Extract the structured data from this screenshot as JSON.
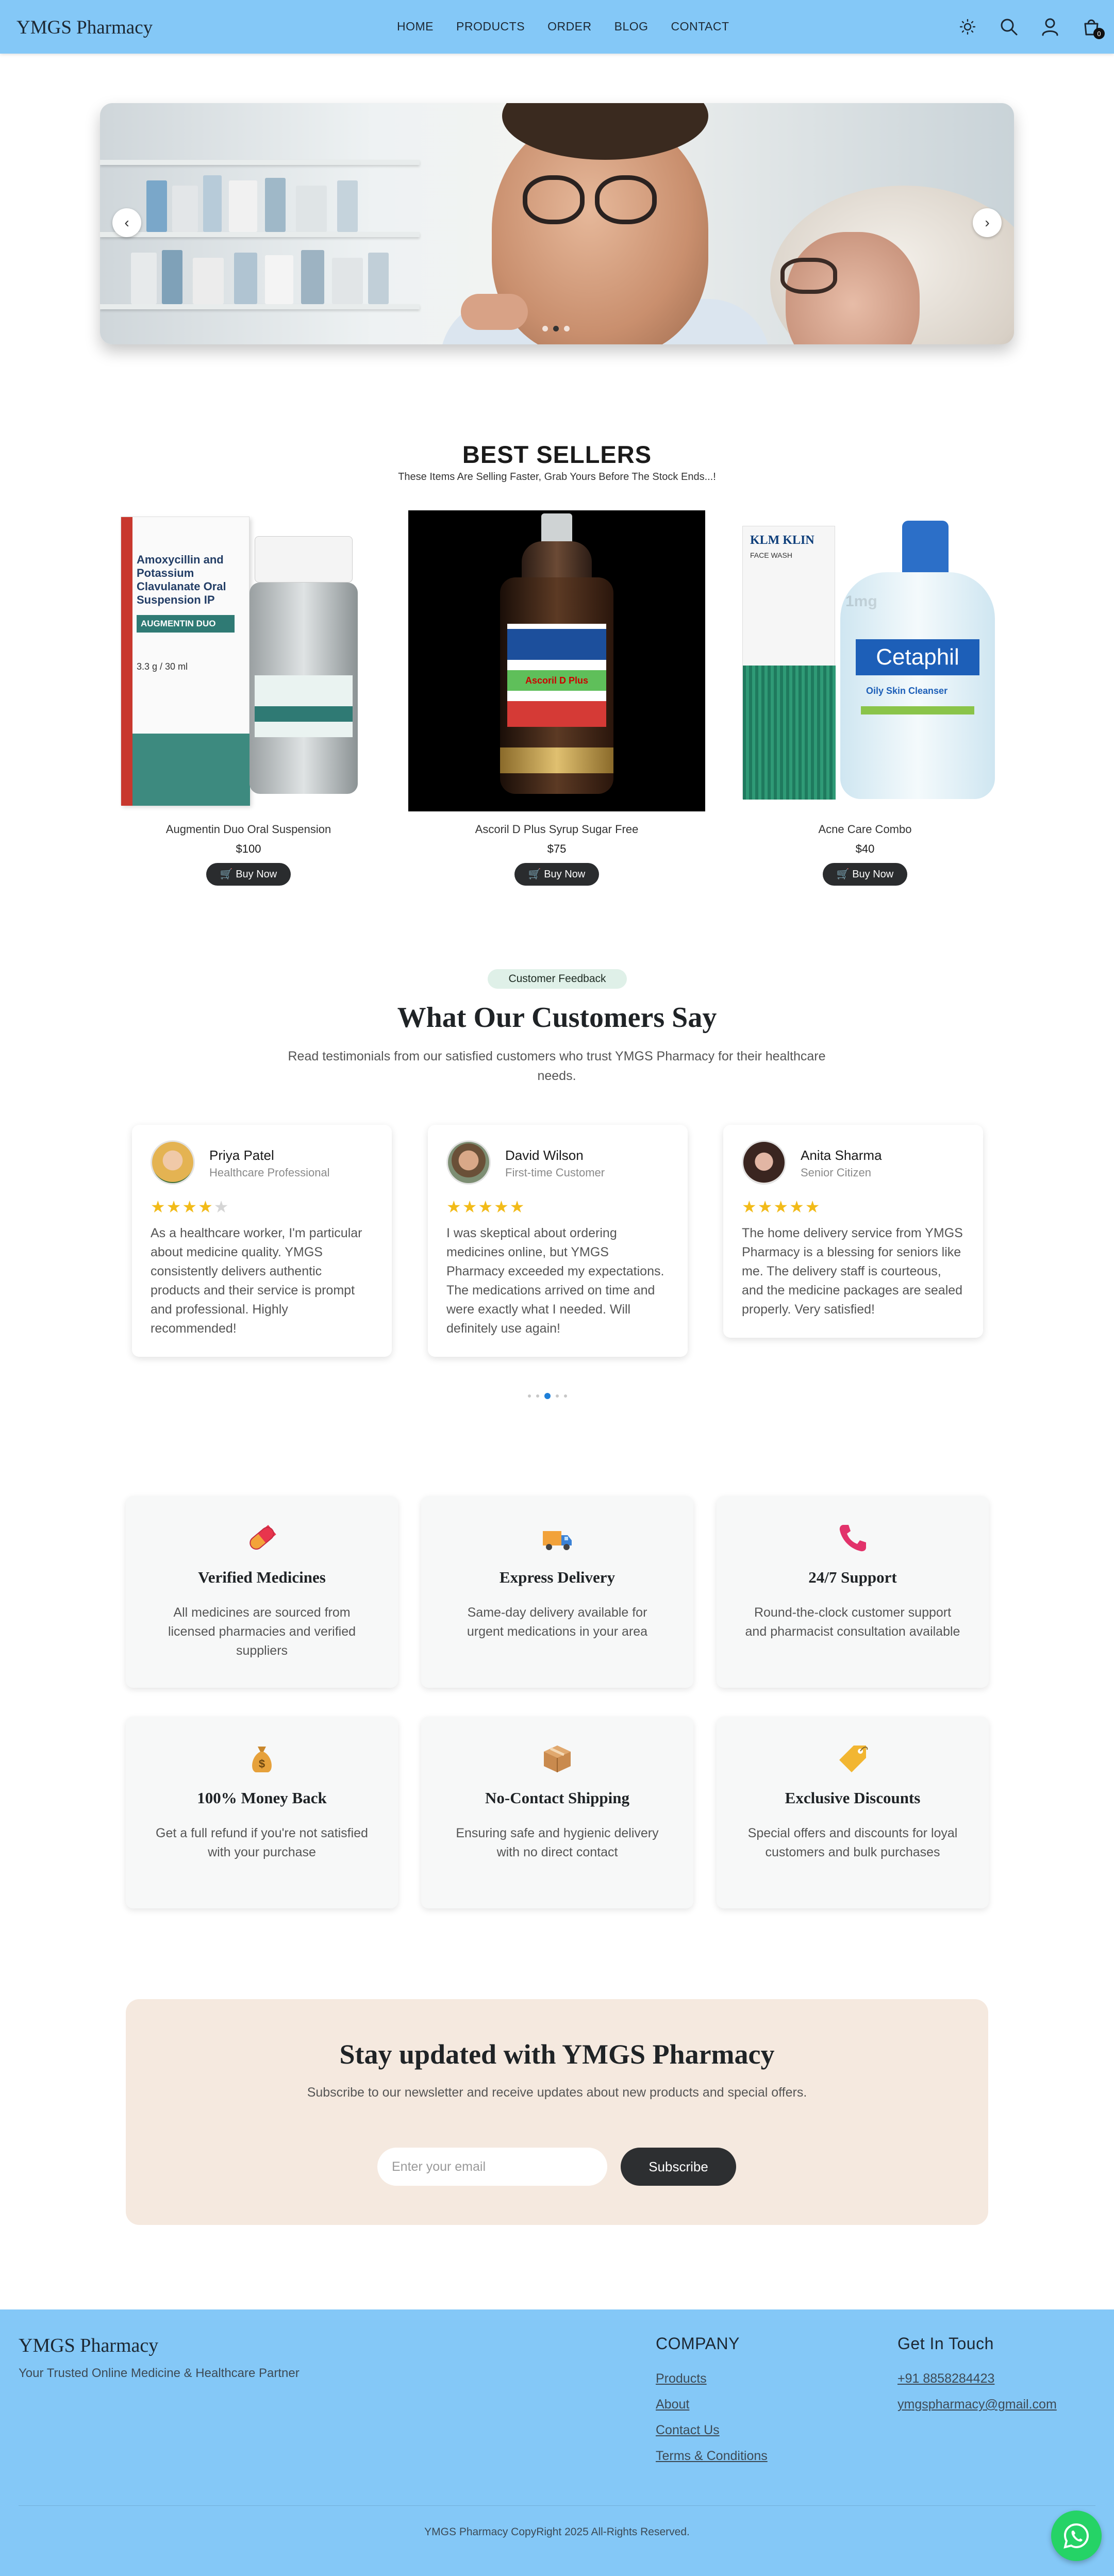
{
  "header": {
    "logo": "YMGS Pharmacy",
    "nav": [
      "HOME",
      "PRODUCTS",
      "ORDER",
      "BLOG",
      "CONTACT"
    ],
    "icons": [
      "sun-icon",
      "search-icon",
      "user-icon",
      "cart-icon"
    ],
    "cart_count": "0",
    "background": "#84c8f7"
  },
  "hero": {
    "prev_symbol": "‹",
    "next_symbol": "›",
    "slide_count": 3,
    "active_slide": 2
  },
  "best_sellers": {
    "title": "BEST SELLERS",
    "subtitle": "These Items Are Selling Faster, Grab Yours Before The Stock Ends...!",
    "products": [
      {
        "name": "Augmentin Duo Oral Suspension",
        "price": "$100",
        "button": "Buy Now"
      },
      {
        "name": "Ascoril D Plus Syrup Sugar Free",
        "price": "$75",
        "button": "Buy Now"
      },
      {
        "name": "Acne Care Combo",
        "price": "$40",
        "button": "Buy Now"
      }
    ],
    "image_texts": {
      "augmentin_box": "Amoxycillin and Potassium Clavulanate Oral Suspension IP",
      "augmentin_brand": "AUGMENTIN DUO",
      "augmentin_size": "3.3 g / 30 ml",
      "ascoril_label": "Ascoril D Plus",
      "klm_brand": "KLM KLIN",
      "klm_sub": "FACE WASH",
      "cetaphil_brand": "Cetaphil",
      "cetaphil_sub": "Oily Skin Cleanser",
      "watermark": "1mg"
    }
  },
  "testimonials": {
    "badge": "Customer Feedback",
    "title": "What Our Customers Say",
    "subtitle": "Read testimonials from our satisfied customers who trust YMGS Pharmacy for their healthcare needs.",
    "items": [
      {
        "name": "Priya Patel",
        "role": "Healthcare Professional",
        "rating": 4,
        "quote": "As a healthcare worker, I'm particular about medicine quality. YMGS consistently delivers authentic products and their service is prompt and professional. Highly recommended!"
      },
      {
        "name": "David Wilson",
        "role": "First-time Customer",
        "rating": 5,
        "quote": "I was skeptical about ordering medicines online, but YMGS Pharmacy exceeded my expectations. The medications arrived on time and were exactly what I needed. Will definitely use again!"
      },
      {
        "name": "Anita Sharma",
        "role": "Senior Citizen",
        "rating": 5,
        "quote": "The home delivery service from YMGS Pharmacy is a blessing for seniors like me. The delivery staff is courteous, and the medicine packages are sealed properly. Very satisfied!"
      }
    ],
    "page_count": 5,
    "active_page": 3
  },
  "features": [
    {
      "icon": "pill-icon",
      "title": "Verified Medicines",
      "desc": "All medicines are sourced from licensed pharmacies and verified suppliers"
    },
    {
      "icon": "delivery-truck-icon",
      "title": "Express Delivery",
      "desc": "Same-day delivery available for urgent medications in your area"
    },
    {
      "icon": "phone-icon",
      "title": "24/7 Support",
      "desc": "Round-the-clock customer support and pharmacist consultation available"
    },
    {
      "icon": "money-bag-icon",
      "title": "100% Money Back",
      "desc": "Get a full refund if you're not satisfied with your purchase"
    },
    {
      "icon": "package-icon",
      "title": "No-Contact Shipping",
      "desc": "Ensuring safe and hygienic delivery with no direct contact"
    },
    {
      "icon": "price-tag-icon",
      "title": "Exclusive Discounts",
      "desc": "Special offers and discounts for loyal customers and bulk purchases"
    }
  ],
  "newsletter": {
    "title": "Stay updated with YMGS Pharmacy",
    "subtitle": "Subscribe to our newsletter and receive updates about new products and special offers.",
    "placeholder": "Enter your email",
    "button": "Subscribe",
    "background": "#f5e9df"
  },
  "footer": {
    "logo": "YMGS Pharmacy",
    "tagline": "Your Trusted Online Medicine & Healthcare Partner",
    "company_title": "COMPANY",
    "company_links": [
      "Products",
      "About",
      "Contact Us",
      "Terms & Conditions"
    ],
    "contact_title": "Get In Touch",
    "phone": "+91 8858284423",
    "email": "ymgspharmacy@gmail.com",
    "copyright": "YMGS Pharmacy CopyRight 2025 All-Rights Reserved."
  },
  "colors": {
    "accent_blue": "#84c8f7",
    "button_dark": "#2a2c2e",
    "star": "#f2bb19",
    "whatsapp": "#25d366"
  }
}
